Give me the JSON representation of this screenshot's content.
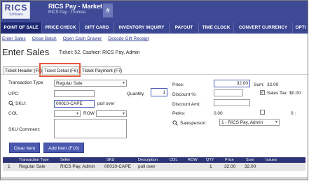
{
  "header": {
    "logo_text": "RICS",
    "logo_sub": "Software",
    "store": "RICS Pay - Market St",
    "user": "RICS Pay - Thomas",
    "hash_icon": "#"
  },
  "nav": {
    "items": [
      "POINT OF SALE",
      "PRICE CHECK",
      "GIFT CARD",
      "INVENTORY INQUIRY",
      "PAYOUT",
      "TIME CLOCK",
      "CONVERT CURRENCY",
      "OPTI"
    ]
  },
  "subnav": [
    "Enter Sales",
    "Close Batch",
    "Open Cash Drawer",
    "Decode Gift Receipt"
  ],
  "page": {
    "title": "Enter Sales",
    "ticket_info": "Ticket: 52, Cashier: RICS Pay, Admin"
  },
  "tabs": [
    "Ticket Header (F5)",
    "Ticket Detail (F6)",
    "Ticket Payment (F7)"
  ],
  "form": {
    "transaction_type_label": "Transaction Type",
    "transaction_type_value": "Regular Sale",
    "quantity_label": "Quantity",
    "quantity_value": "1",
    "upc_label": "UPC:",
    "sku_label": "SKU:",
    "sku_value": "00010-CAPE",
    "pull_over": "pull over",
    "col_label": "COL",
    "row_label": "ROW",
    "sku_comment_label": "SKU Comment:",
    "price_label": "Price:",
    "price_value": "32.00",
    "sum_label": "Sum:",
    "sum_value": "32.00",
    "discount_pct_label": "Discount %:",
    "sales_tax_label": "Sales Tax",
    "sales_tax_amount": "$0.00 :",
    "discount_amt_label": "Discount Amt:",
    "perks_label": "Perks:",
    "perks_value": "0.00",
    "perks_extra": "0 :",
    "salesperson_label": "Salesperson:",
    "salesperson_value": "1 - RICS Pay, Admin"
  },
  "buttons": {
    "clear": "Clear Item",
    "add": "Add Item (F10)"
  },
  "table": {
    "headers": [
      "Transaction Type",
      "Seller",
      "SKU",
      "Description",
      "COL",
      "ROW",
      "QTY",
      "Price",
      "Sum",
      "Issues"
    ],
    "rows": [
      [
        "1",
        "Regular Sale",
        "RICS Pay, Admin",
        "00010-CAPE",
        "pull over",
        "",
        "",
        "1",
        "32.00",
        "32.00"
      ]
    ]
  }
}
